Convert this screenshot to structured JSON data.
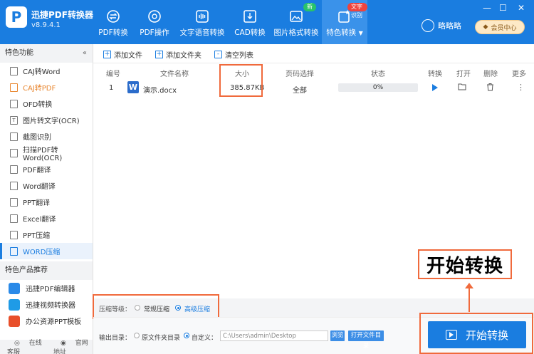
{
  "app": {
    "name": "迅捷PDF转换器",
    "version": "v8.9.4.1",
    "logo_letter": "P"
  },
  "nav": [
    {
      "label": "PDF转换",
      "icon": "swap-icon"
    },
    {
      "label": "PDF操作",
      "icon": "gear-icon"
    },
    {
      "label": "文字语音转换",
      "icon": "audio-wave-icon"
    },
    {
      "label": "CAD转换",
      "icon": "download-box-icon"
    },
    {
      "label": "图片格式转换",
      "icon": "image-icon",
      "badge": "新"
    },
    {
      "label": "特色转换",
      "icon": "star-box-icon",
      "badge": "文字识别",
      "active": true,
      "chevron": "▼"
    }
  ],
  "user": {
    "name": "略略略",
    "vip_label": "会员中心"
  },
  "window": {
    "minimize": "—",
    "maximize": "☐",
    "close": "✕"
  },
  "sidebar": {
    "section_features": "特色功能",
    "items": [
      {
        "label": "CAJ转Word"
      },
      {
        "label": "CAJ转PDF"
      },
      {
        "label": "OFD转换"
      },
      {
        "label": "图片转文字(OCR)"
      },
      {
        "label": "截图识别"
      },
      {
        "label": "扫描PDF转Word(OCR)"
      },
      {
        "label": "PDF翻译"
      },
      {
        "label": "Word翻译"
      },
      {
        "label": "PPT翻译"
      },
      {
        "label": "Excel翻译"
      },
      {
        "label": "PPT压缩"
      },
      {
        "label": "WORD压缩"
      }
    ],
    "section_products": "特色产品推荐",
    "products": [
      {
        "label": "迅捷PDF编辑器"
      },
      {
        "label": "迅捷视频转换器"
      },
      {
        "label": "办公资源PPT模板"
      }
    ],
    "footer": {
      "service": "在线客服",
      "website": "官网地址"
    },
    "colors": {
      "active": "#1a7de0",
      "orange": "#e8862f"
    }
  },
  "toolbar": {
    "add_file": "添加文件",
    "add_folder": "添加文件夹",
    "clear_list": "清空列表"
  },
  "table": {
    "headers": {
      "index": "编号",
      "filename": "文件名称",
      "size": "大小",
      "page_select": "页码选择",
      "status": "状态",
      "convert": "转换",
      "open": "打开",
      "delete": "删除",
      "more": "更多"
    },
    "rows": [
      {
        "index": "1",
        "filename": "演示.docx",
        "size": "385.87KB",
        "pages": "全部",
        "progress": "0%"
      }
    ]
  },
  "compress": {
    "label": "压缩等级：",
    "normal": "常规压缩",
    "high": "高级压缩",
    "selected": "high"
  },
  "output": {
    "label": "输出目录：",
    "source_dir": "原文件夹目录",
    "custom": "自定义：",
    "path": "C:\\Users\\admin\\Desktop",
    "browse": "浏览",
    "open_dir": "打开文件目录"
  },
  "start_button": "开始转换",
  "callout_text": "开始转换",
  "accent": "#1a7de0",
  "highlight": "#f06a3c"
}
